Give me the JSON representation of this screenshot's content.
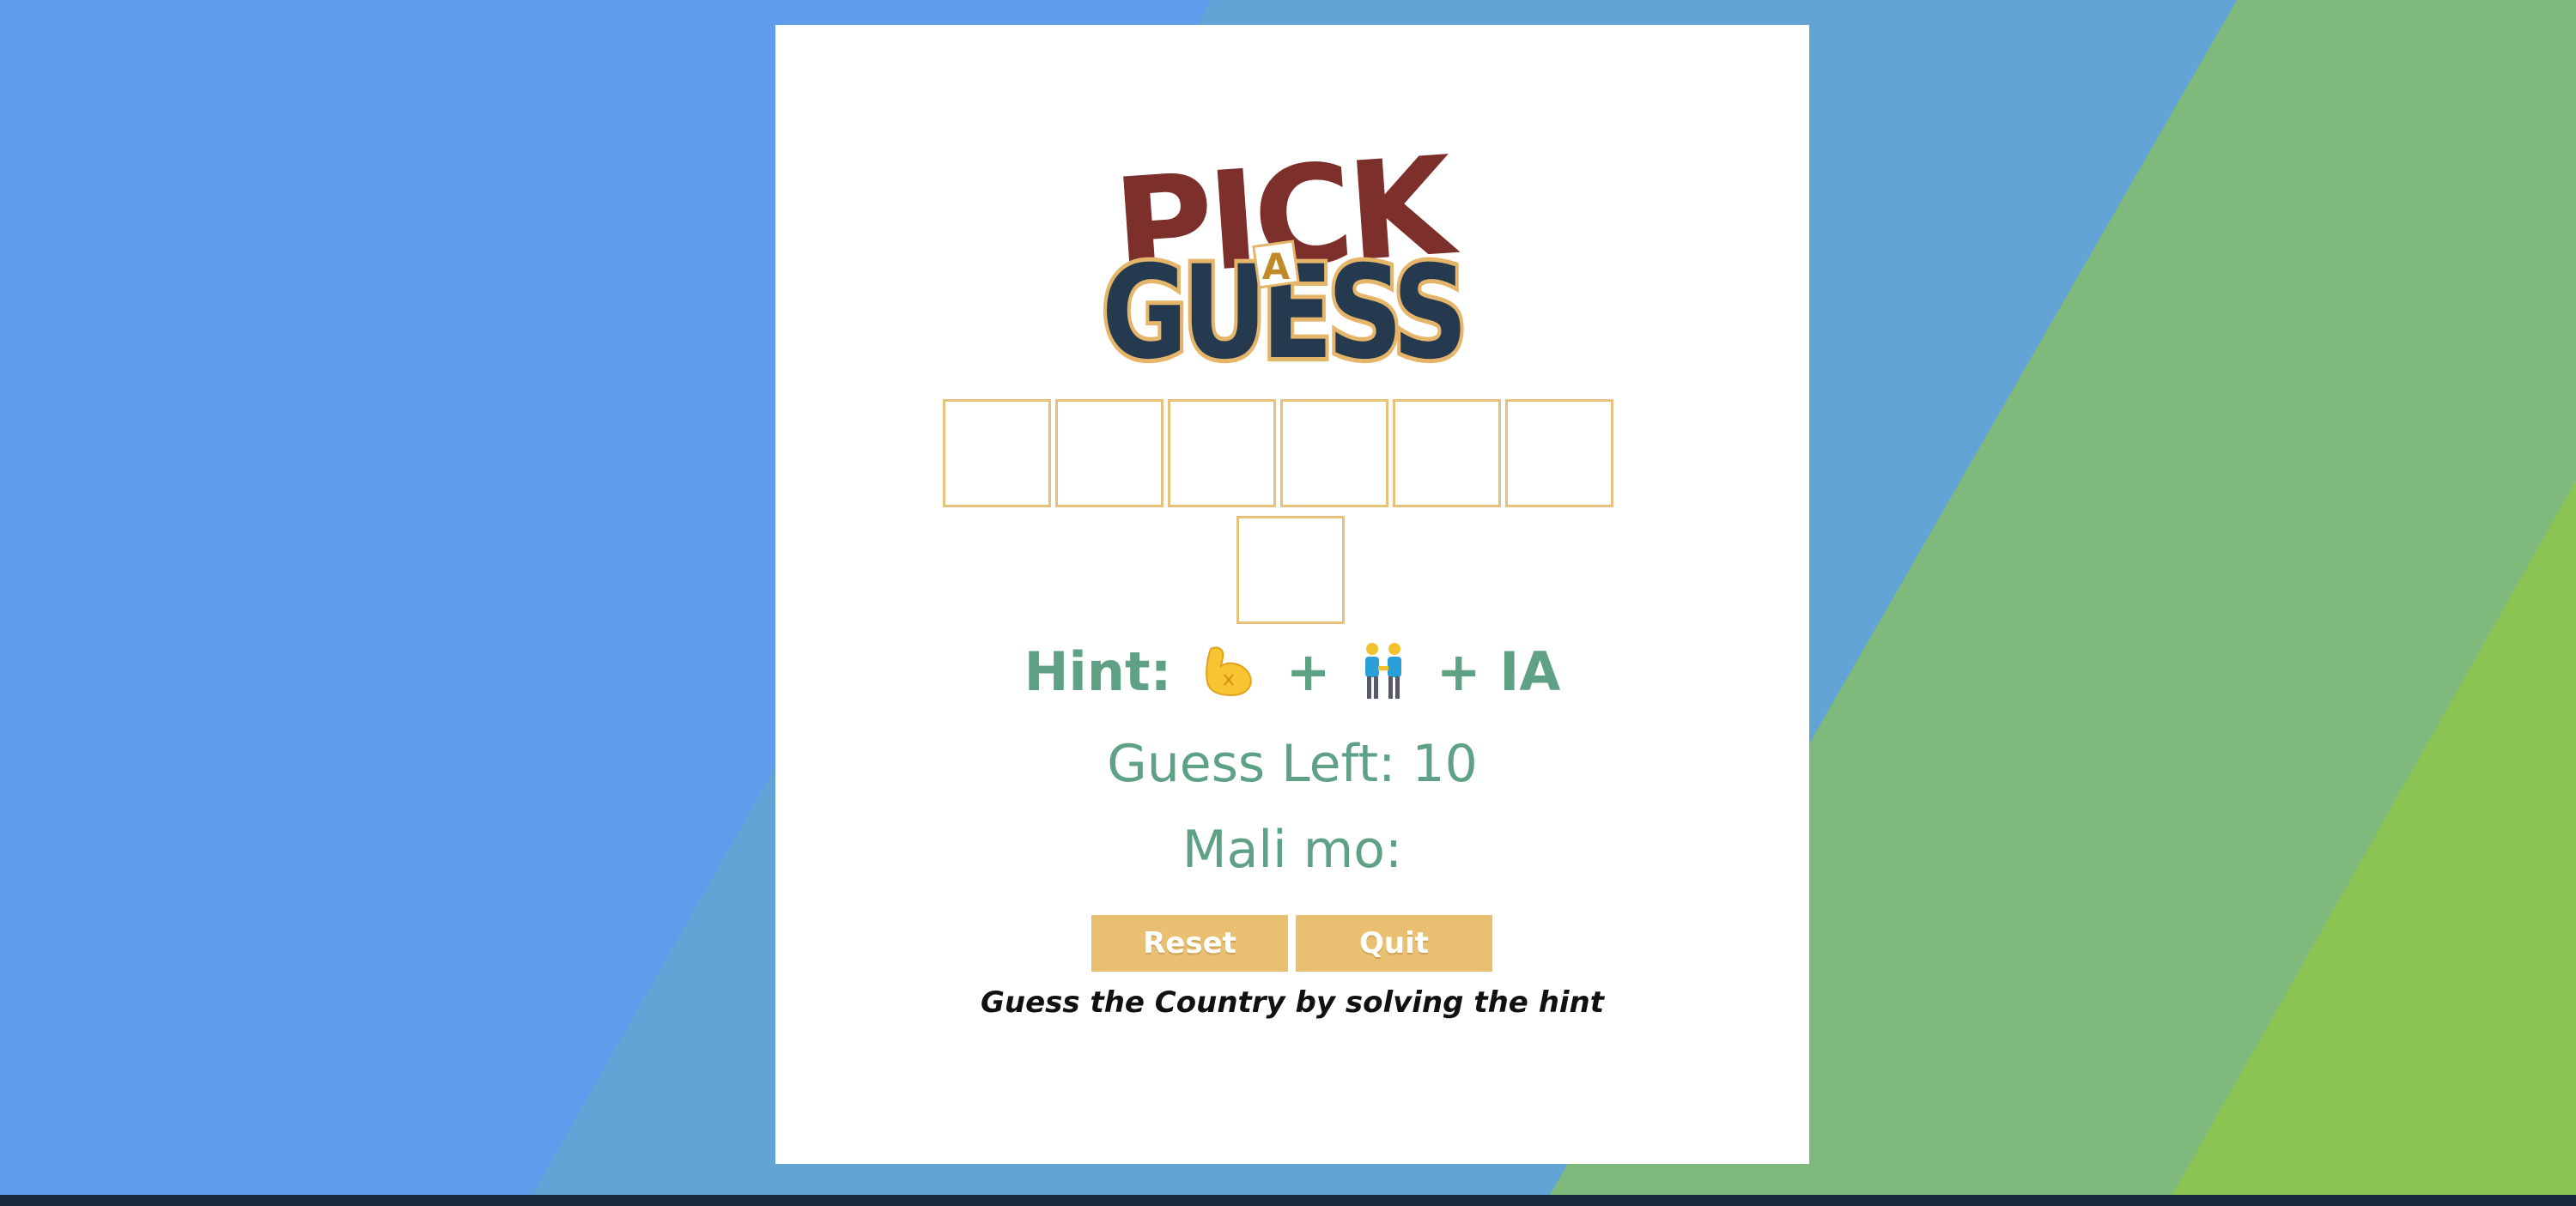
{
  "colors": {
    "background_blue": "#5f9ceb",
    "background_mid_blue": "#63a4d6",
    "background_green": "#7fb97b",
    "background_light_green": "#8bc452",
    "card": "#ffffff",
    "box_border": "#e8c27a",
    "text_teal": "#5fa184",
    "button": "#e9bf71",
    "logo_red": "#7d302b",
    "logo_navy": "#263a4f",
    "logo_outline": "#e5b56a"
  },
  "logo": {
    "line1": "PICK",
    "line2": "A",
    "line3": "GUESS"
  },
  "board": {
    "total_letters": 7,
    "row1_count": 6,
    "row2_count": 1,
    "letters": [
      "",
      "",
      "",
      "",
      "",
      "",
      ""
    ]
  },
  "hint": {
    "label": "Hint:",
    "plus1": "+",
    "emoji1": "flexed-biceps-icon",
    "emoji2": "two-men-holding-hands-icon",
    "suffix": "+ IA"
  },
  "status": {
    "guesses_left": "Guess Left: 10",
    "wrong_letters_label": "Mali mo:"
  },
  "buttons": {
    "reset": "Reset",
    "quit": "Quit"
  },
  "instruction": "Guess the Country by solving the hint"
}
